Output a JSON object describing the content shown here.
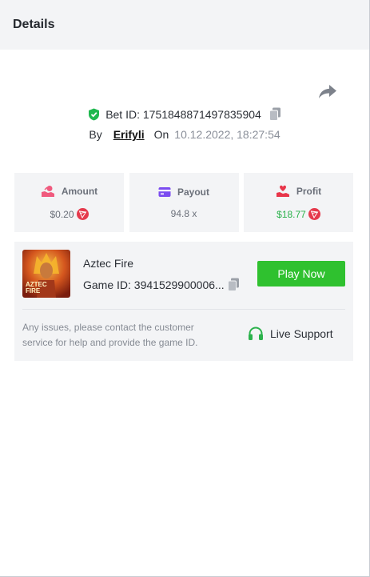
{
  "header": {
    "title": "Details"
  },
  "bet": {
    "id_label": "Bet ID:",
    "id_value": "1751848871497835904",
    "by_label": "By",
    "username": "Erifyli",
    "on_label": "On",
    "datetime": "10.12.2022, 18:27:54"
  },
  "stats": {
    "amount": {
      "label": "Amount",
      "value": "$0.20",
      "icon": "hand-coins-icon"
    },
    "payout": {
      "label": "Payout",
      "value": "94.8 x",
      "icon": "card-icon"
    },
    "profit": {
      "label": "Profit",
      "value": "$18.77",
      "icon": "hand-heart-icon"
    }
  },
  "game": {
    "thumb_text_1": "AZTEC",
    "thumb_text_2": "FIRE",
    "name": "Aztec Fire",
    "id_text": "Game ID: 3941529900006...",
    "play_label": "Play Now"
  },
  "support": {
    "notice": "Any issues, please contact the customer service for help and provide the game ID.",
    "label": "Live Support"
  },
  "colors": {
    "accent_green": "#2fc12f",
    "profit_green": "#2bb24c",
    "trx_red": "#e5394c",
    "amount_pink": "#f05a7e",
    "payout_purple": "#7b4cf0",
    "profit_red": "#e8364a"
  }
}
